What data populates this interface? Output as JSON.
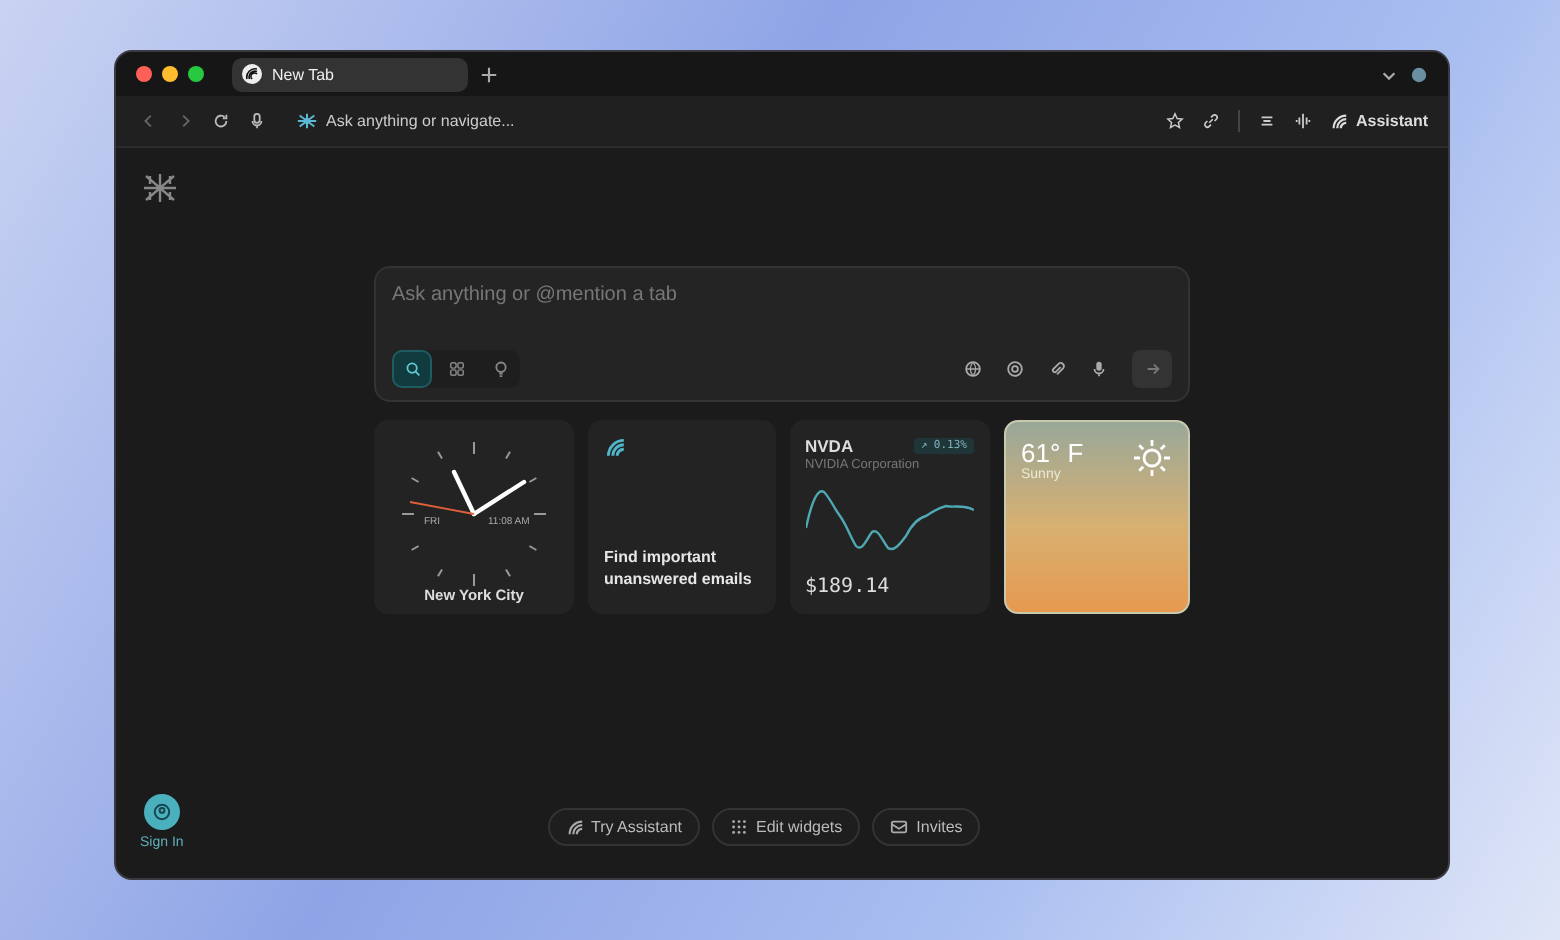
{
  "window": {
    "tab": {
      "title": "New Tab",
      "selected": true
    }
  },
  "toolbar": {
    "address_placeholder": "Ask anything or navigate...",
    "assistant_label": "Assistant"
  },
  "prompt": {
    "placeholder": "Ask anything or @mention a tab",
    "modes": [
      {
        "kind": "search",
        "selected": true
      },
      {
        "kind": "apps",
        "selected": false
      },
      {
        "kind": "idea",
        "selected": false
      }
    ]
  },
  "widgets": [
    {
      "kind": "clock",
      "day": "FRI",
      "time": "11:08 AM",
      "city": "New York City"
    },
    {
      "kind": "assistant",
      "text": "Find important unanswered emails"
    },
    {
      "kind": "stock",
      "symbol": "NVDA",
      "change": "↗ 0.13%",
      "company": "NVIDIA Corporation",
      "price": "$189.14"
    },
    {
      "kind": "weather",
      "temperature": "61° F",
      "condition": "Sunny"
    }
  ],
  "sign_in": {
    "label": "Sign In"
  },
  "bottom_buttons": [
    {
      "kind": "assistant",
      "label": "Try Assistant"
    },
    {
      "kind": "widgets",
      "label": "Edit widgets"
    },
    {
      "kind": "mail",
      "label": "Invites"
    }
  ]
}
